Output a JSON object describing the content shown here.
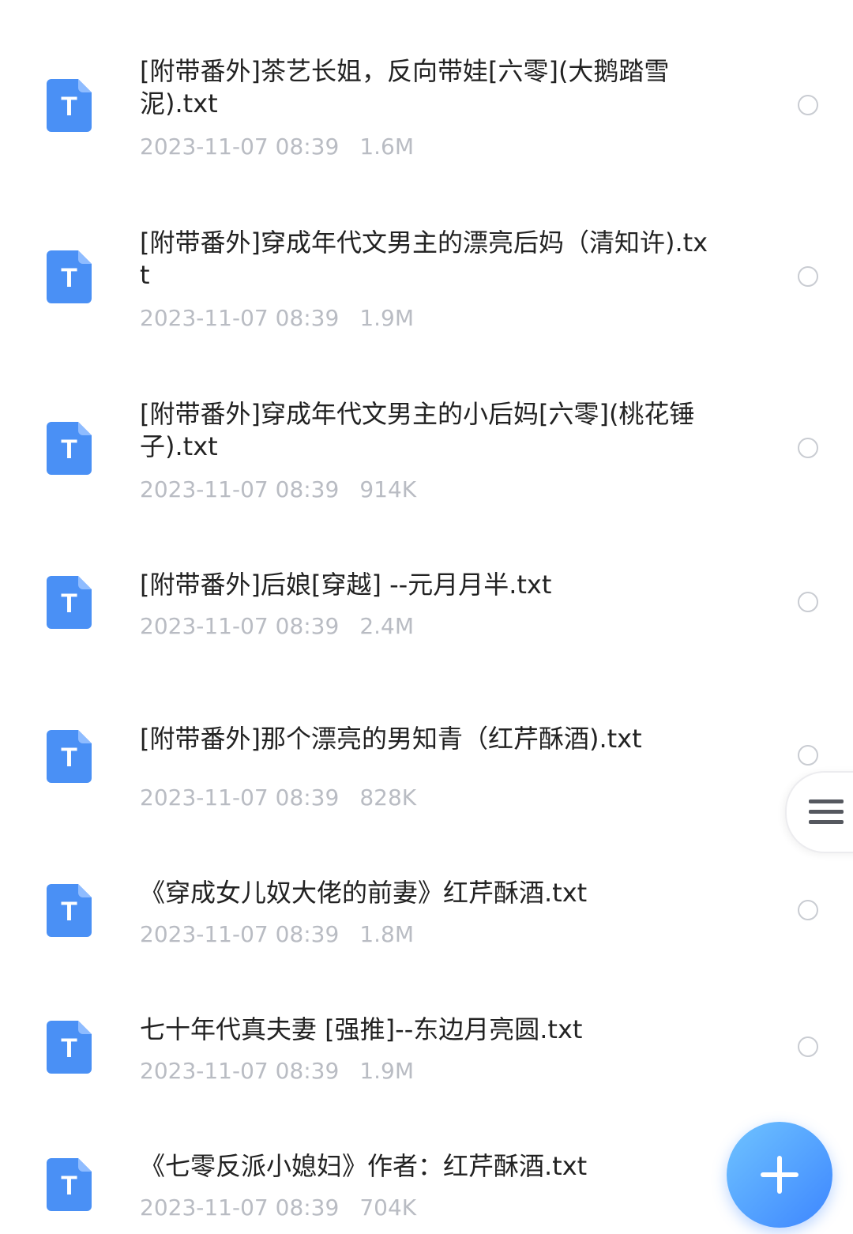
{
  "files": [
    {
      "name": "[附带番外]茶艺长姐，反向带娃[六零](大鹅踏雪泥).txt",
      "date": "2023-11-07 08:39",
      "size": "1.6M",
      "icon": "txt-file-icon",
      "icon_letter": "T"
    },
    {
      "name": "[附带番外]穿成年代文男主的漂亮后妈（清知许).txt",
      "date": "2023-11-07 08:39",
      "size": "1.9M",
      "icon": "txt-file-icon",
      "icon_letter": "T"
    },
    {
      "name": "[附带番外]穿成年代文男主的小后妈[六零](桃花锤子).txt",
      "date": "2023-11-07 08:39",
      "size": "914K",
      "icon": "txt-file-icon",
      "icon_letter": "T"
    },
    {
      "name": "[附带番外]后娘[穿越] --元月月半.txt",
      "date": "2023-11-07 08:39",
      "size": "2.4M",
      "icon": "txt-file-icon",
      "icon_letter": "T"
    },
    {
      "name": "[附带番外]那个漂亮的男知青（红芹酥酒).txt",
      "date": "2023-11-07 08:39",
      "size": "828K",
      "icon": "txt-file-icon",
      "icon_letter": "T"
    },
    {
      "name": "《穿成女儿奴大佬的前妻》红芹酥酒.txt",
      "date": "2023-11-07 08:39",
      "size": "1.8M",
      "icon": "txt-file-icon",
      "icon_letter": "T"
    },
    {
      "name": "七十年代真夫妻 [强推]--东边月亮圆.txt",
      "date": "2023-11-07 08:39",
      "size": "1.9M",
      "icon": "txt-file-icon",
      "icon_letter": "T"
    },
    {
      "name": "《七零反派小媳妇》作者：红芹酥酒.txt",
      "date": "2023-11-07 08:39",
      "size": "704K",
      "icon": "txt-file-icon",
      "icon_letter": "T"
    }
  ],
  "side_menu": {
    "icon": "hamburger-menu-icon"
  },
  "fab": {
    "icon": "plus-icon"
  },
  "colors": {
    "accent": "#4a90f5",
    "meta_text": "#b9bcc3",
    "title_text": "#222222",
    "fab_gradient_start": "#6fc3ff",
    "fab_gradient_end": "#3d86ff"
  }
}
